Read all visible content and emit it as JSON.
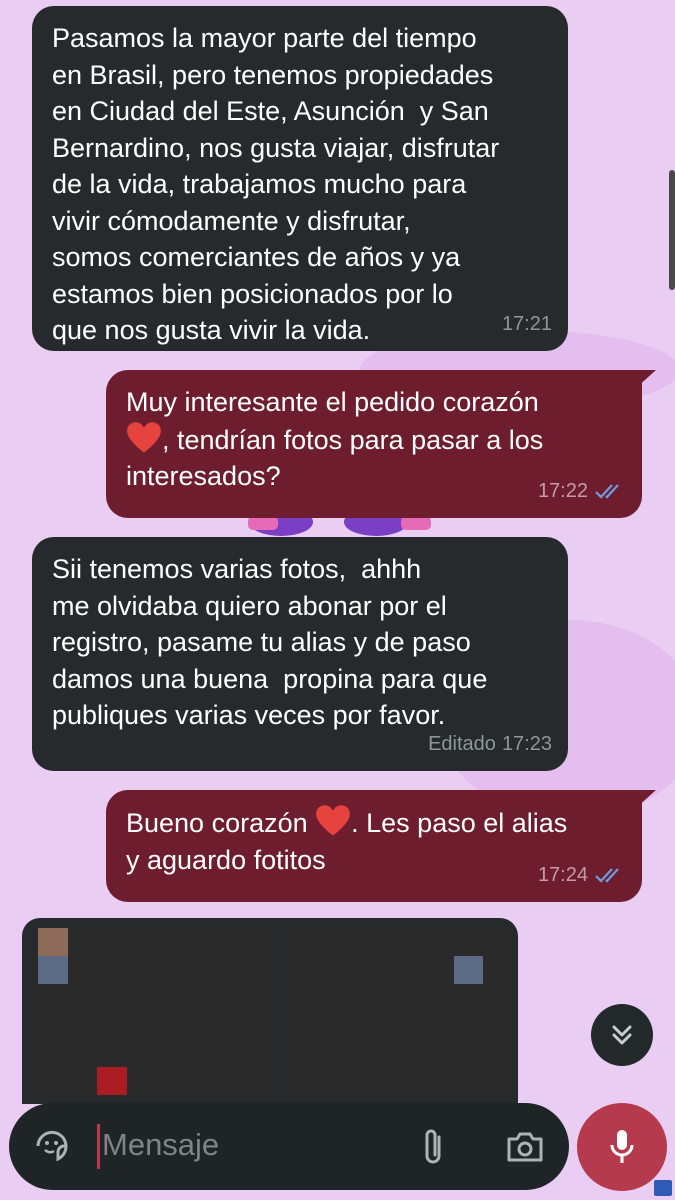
{
  "messages": [
    {
      "direction": "incoming",
      "text": "Pasamos la mayor parte del tiempo\nen Brasil, pero tenemos propiedades\nen Ciudad del Este, Asunción  y San\nBernardino, nos gusta viajar, disfrutar\nde la vida, trabajamos mucho para\nvivir cómodamente y disfrutar,\nsomos comerciantes de años y ya\nestamos bien posicionados por lo\nque nos gusta vivir la vida.",
      "time": "17:21"
    },
    {
      "direction": "outgoing",
      "text_before": "Muy interesante el pedido corazón\n",
      "text_after": ", tendrían fotos para pasar a los\ninteresados?",
      "time": "17:22"
    },
    {
      "direction": "incoming",
      "text": "Sii tenemos varias fotos,  ahhh\nme olvidaba quiero abonar por el\nregistro, pasame tu alias y de paso\ndamos una buena  propina para que\npubliques varias veces por favor.",
      "edited": "Editado",
      "time": "17:23"
    },
    {
      "direction": "outgoing",
      "text_before": "Bueno corazón ",
      "text_after": ". Les paso el alias\ny aguardo fotitos",
      "time": "17:24"
    }
  ],
  "composer": {
    "placeholder": "Mensaje"
  },
  "icons": {
    "sticker": "sticker-icon",
    "attach": "paperclip-icon",
    "camera": "camera-icon",
    "mic": "microphone-icon",
    "scroll": "chevron-double-down-icon",
    "read": "double-check-icon"
  },
  "colors": {
    "incoming": "#262a2c",
    "outgoing": "#6e1d2e",
    "background": "#eacdf2",
    "read_ticks": "#6f9be0",
    "mic": "#b53a4d"
  }
}
